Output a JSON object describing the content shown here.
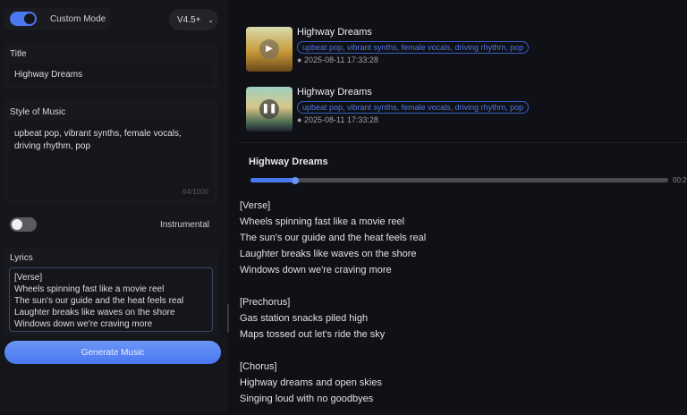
{
  "sidebar": {
    "custom_mode": {
      "label": "Custom Mode",
      "on": true
    },
    "version": "V4.5+",
    "title": {
      "label": "Title",
      "value": "Highway Dreams"
    },
    "style": {
      "label": "Style of Music",
      "value": "upbeat pop, vibrant synths, female vocals, driving rhythm, pop",
      "counter": "64/1000"
    },
    "instrumental": {
      "label": "Instrumental",
      "on": false
    },
    "lyrics": {
      "label": "Lyrics",
      "value": "[Verse]\nWheels spinning fast like a movie reel\nThe sun's our guide and the heat feels real\nLaughter breaks like waves on the shore\nWindows down we're craving more"
    },
    "generate_label": "Generate Music"
  },
  "songs": [
    {
      "title": "Highway Dreams",
      "tags": "upbeat pop, vibrant synths, female vocals, driving rhythm, pop",
      "date": "2025-08-11 17:33:28",
      "state": "play"
    },
    {
      "title": "Highway Dreams",
      "tags": "upbeat pop, vibrant synths, female vocals, driving rhythm, pop",
      "date": "2025-08-11 17:33:28",
      "state": "pause"
    }
  ],
  "player": {
    "title": "Highway Dreams",
    "progress_percent": 11,
    "time": "00:2"
  },
  "lyrics_text": "[Verse]\nWheels spinning fast like a movie reel\nThe sun's our guide and the heat feels real\nLaughter breaks like waves on the shore\nWindows down we're craving more\n\n[Prechorus]\nGas station snacks piled high\nMaps tossed out let's ride the sky\n\n[Chorus]\nHighway dreams and open skies\nSinging loud with no goodbyes",
  "colors": {
    "accent": "#4a78f0",
    "tag": "#4e78e8"
  }
}
